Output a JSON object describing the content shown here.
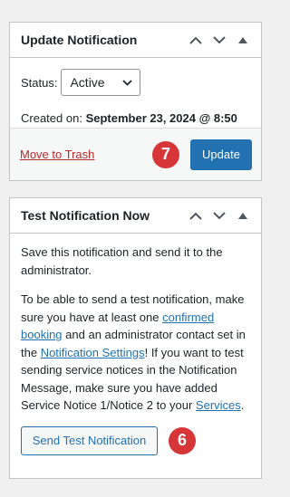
{
  "update_panel": {
    "title": "Update Notification",
    "status_label": "Status:",
    "status_value": "Active",
    "created_label": "Created on:",
    "created_value": "September 23, 2024 @ 8:50 am",
    "trash_label": "Move to Trash",
    "update_label": "Update",
    "badge": "7"
  },
  "test_panel": {
    "title": "Test Notification Now",
    "para1": "Save this notification and send it to the administrator.",
    "para2": {
      "t1": "To be able to send a test notification, make sure you have at least one ",
      "link1": "confirmed booking",
      "t2": " and an administrator contact set in the ",
      "link2": "Notification Settings",
      "t3": "! If you want to test sending service notices in the Notification Message, make sure you have added Service Notice 1/Notice 2 to your ",
      "link3": "Services",
      "t4": "."
    },
    "send_label": "Send Test Notification",
    "badge": "6"
  },
  "icons": {
    "move_up": "chevron-up-icon",
    "move_down": "chevron-down-icon",
    "toggle": "triangle-up-icon"
  },
  "colors": {
    "primary": "#2271b1",
    "danger": "#b32d2e",
    "badge": "#d63638"
  }
}
